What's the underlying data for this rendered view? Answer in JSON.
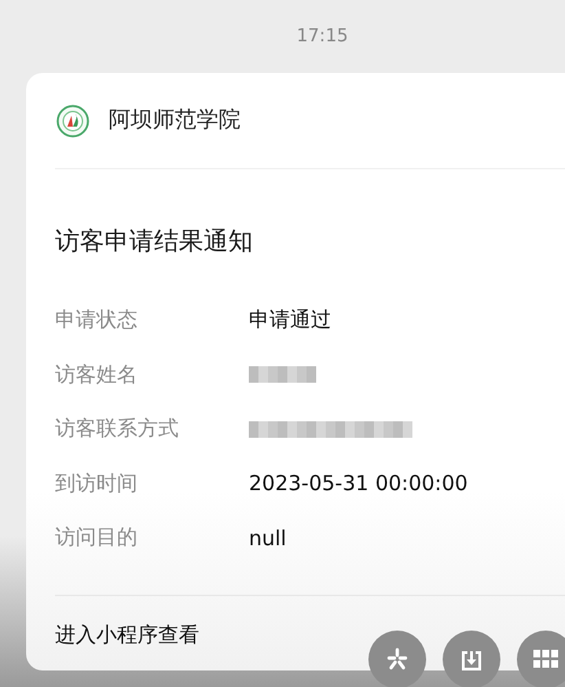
{
  "status_time": "17:15",
  "card": {
    "sender": "阿坝师范学院",
    "title": "访客申请结果通知",
    "fields": [
      {
        "label": "申请状态",
        "kind": "text",
        "value": "申请通过"
      },
      {
        "label": "访客姓名",
        "kind": "redacted"
      },
      {
        "label": "访客联系方式",
        "kind": "redacted_long"
      },
      {
        "label": "到访时间",
        "kind": "text",
        "value": "2023-05-31 00:00:00"
      },
      {
        "label": "访问目的",
        "kind": "text",
        "value": "null"
      }
    ],
    "link": "进入小程序查看"
  },
  "floating_buttons": [
    {
      "kind": "sparkle"
    },
    {
      "kind": "download"
    },
    {
      "kind": "grid"
    }
  ]
}
